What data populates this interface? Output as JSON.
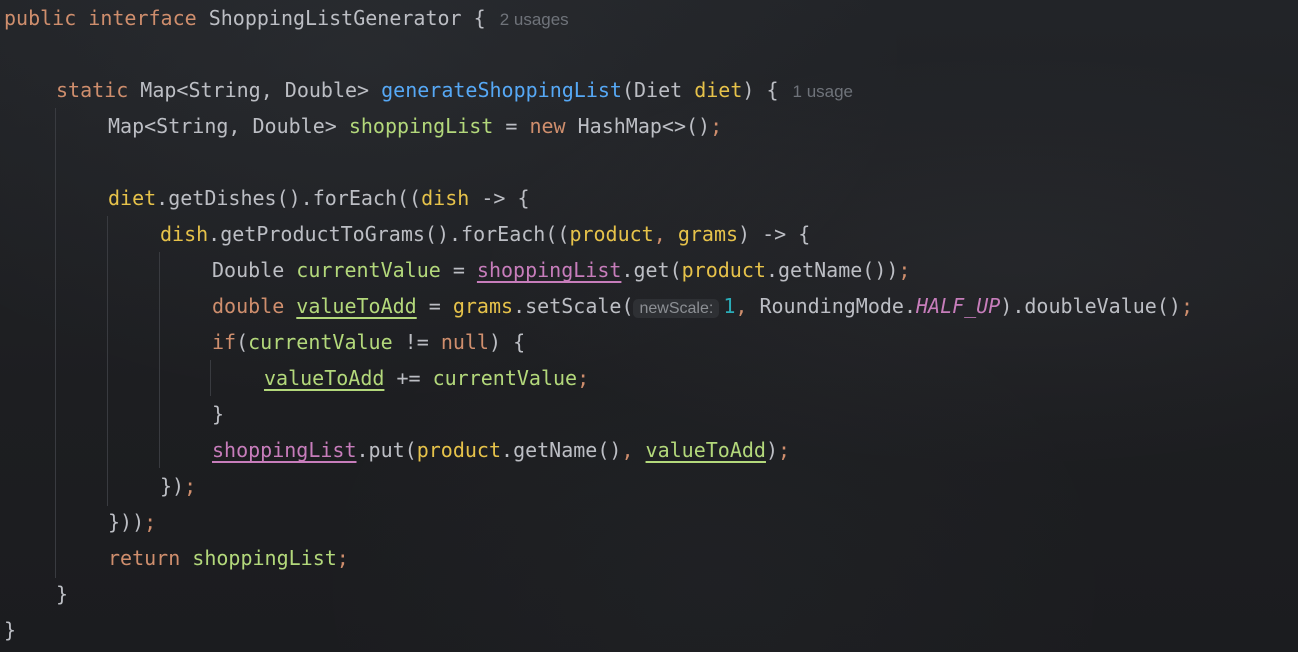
{
  "editor": {
    "hints": {
      "interface_usages": "2 usages",
      "method_usages": "1 usage",
      "new_scale_param": "newScale:"
    },
    "tokens": {
      "kw_public": "public",
      "kw_interface": "interface",
      "kw_static": "static",
      "kw_new": "new",
      "kw_double": "double",
      "kw_if": "if",
      "kw_null": "null",
      "kw_return": "return",
      "interface_name": "ShoppingListGenerator",
      "map_type": "Map<String, Double>",
      "method_name": "generateShoppingList",
      "diet_type": "Diet",
      "diet_param": "diet",
      "shopping_list": "shoppingList",
      "hashmap": "HashMap<>()",
      "get_dishes": "getDishes",
      "for_each": "forEach",
      "dish": "dish",
      "get_product_to_grams": "getProductToGrams",
      "product": "product",
      "grams": "grams",
      "double_type": "Double",
      "current_value": "currentValue",
      "get": "get",
      "get_name": "getName",
      "value_to_add": "valueToAdd",
      "set_scale": "setScale",
      "scale_value": "1",
      "rounding_mode": "RoundingMode",
      "half_up": "HALF_UP",
      "double_value": "doubleValue",
      "put": "put"
    }
  },
  "colors": {
    "background": "#1e1f22",
    "keyword": "#cf8e6d",
    "method": "#56a8f5",
    "local": "#b3d87b",
    "parameter": "#e6c24a",
    "field": "#c77dbb",
    "number": "#2aacb8",
    "text": "#bcbec4"
  }
}
